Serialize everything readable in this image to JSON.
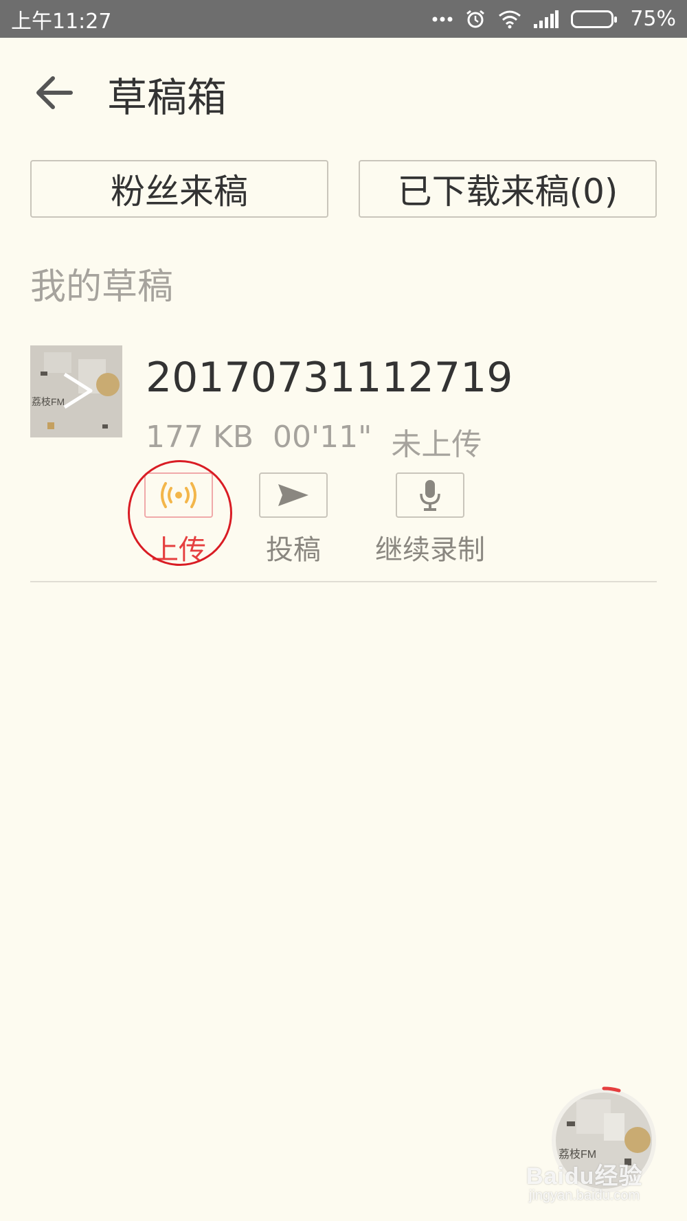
{
  "status_bar": {
    "time": "上午11:27",
    "battery_text": "75%",
    "battery_level": 0.75,
    "icons": [
      "more-dots-icon",
      "alarm-icon",
      "wifi-icon",
      "signal-icon",
      "battery-icon"
    ]
  },
  "header": {
    "title": "草稿箱",
    "back_icon": "arrow-left-icon"
  },
  "top_buttons": {
    "fans_submissions": "粉丝来稿",
    "downloaded_submissions": "已下载来稿(0)"
  },
  "section": {
    "label": "我的草稿"
  },
  "draft": {
    "thumbnail_logo": "荔枝FM",
    "title": "20170731112719",
    "size": "177 KB",
    "duration": "00'11\"",
    "status": "未上传",
    "actions": {
      "upload": "上传",
      "submit": "投稿",
      "continue_record": "继续录制"
    }
  },
  "fab": {
    "logo": "荔枝FM"
  },
  "watermark": {
    "brand": "Baidu经验",
    "url": "jingyan.baidu.com"
  },
  "colors": {
    "background": "#fdfbf0",
    "status_bar": "#6e6e6e",
    "accent_red": "#e53f3f",
    "upload_icon": "#f3b64a",
    "muted_text": "#a6a39d"
  }
}
